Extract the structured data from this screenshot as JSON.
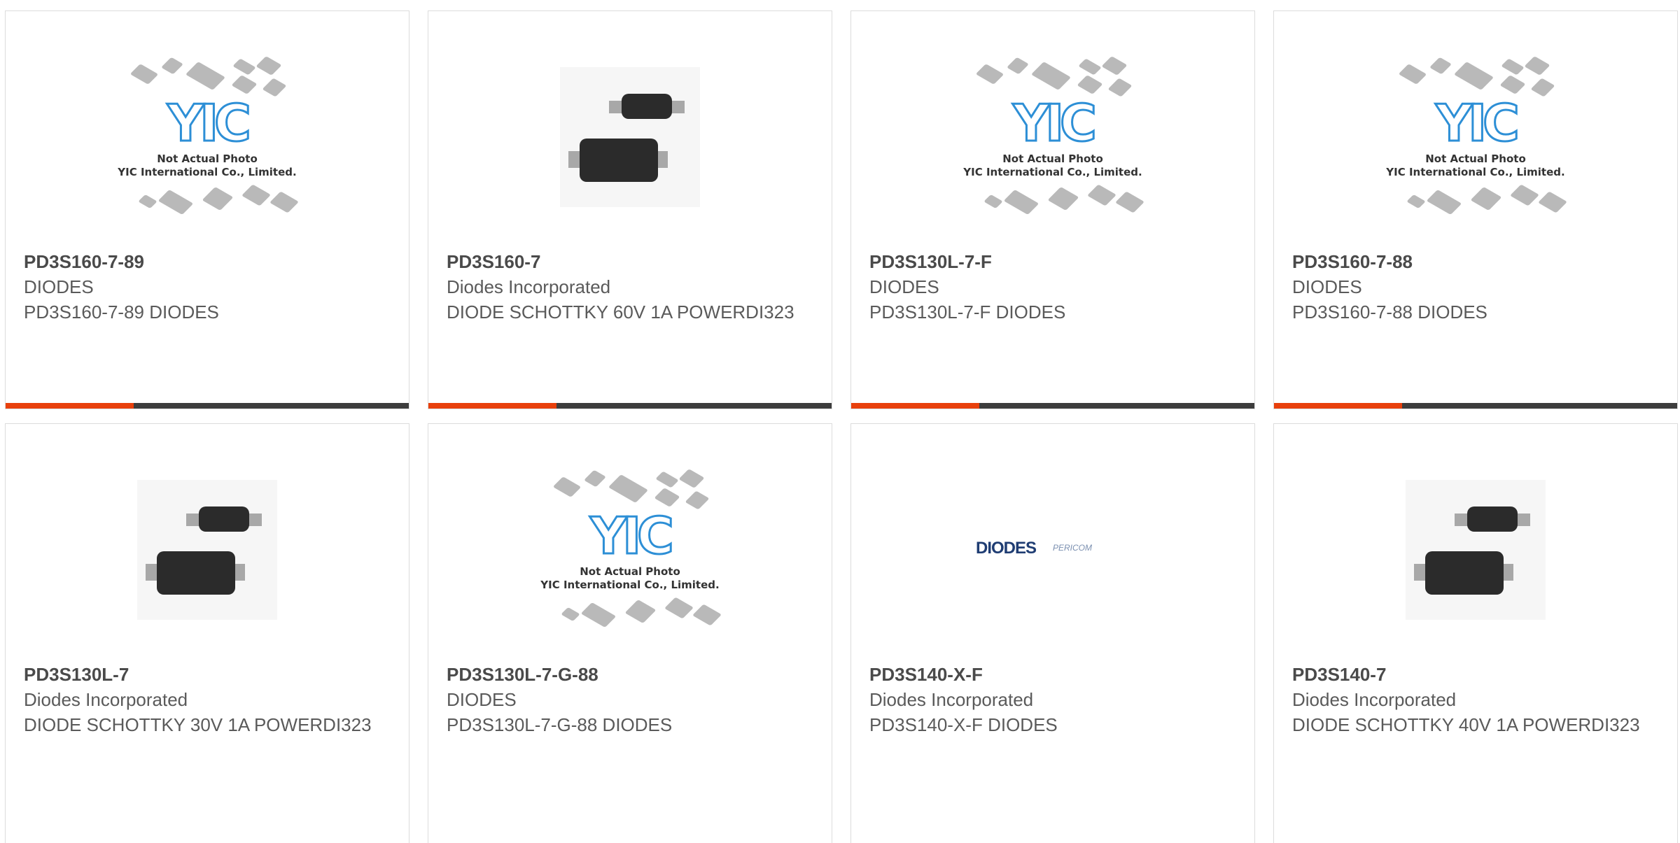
{
  "placeholder": {
    "brand": "YIC",
    "line1": "Not Actual Photo",
    "line2": "YIC International Co., Limited."
  },
  "logo": {
    "diodes": "DIODES",
    "pericom": "PERICOM"
  },
  "products": [
    {
      "part": "PD3S160-7-89",
      "manufacturer": "DIODES",
      "description": "PD3S160-7-89 DIODES",
      "image": "placeholder"
    },
    {
      "part": "PD3S160-7",
      "manufacturer": "Diodes Incorporated",
      "description": "DIODE SCHOTTKY 60V 1A POWERDI323",
      "image": "diode-photo"
    },
    {
      "part": "PD3S130L-7-F",
      "manufacturer": "DIODES",
      "description": "PD3S130L-7-F DIODES",
      "image": "placeholder"
    },
    {
      "part": "PD3S160-7-88",
      "manufacturer": "DIODES",
      "description": "PD3S160-7-88 DIODES",
      "image": "placeholder"
    },
    {
      "part": "PD3S130L-7",
      "manufacturer": "Diodes Incorporated",
      "description": "DIODE SCHOTTKY 30V 1A POWERDI323",
      "image": "diode-photo"
    },
    {
      "part": "PD3S130L-7-G-88",
      "manufacturer": "DIODES",
      "description": "PD3S130L-7-G-88 DIODES",
      "image": "placeholder"
    },
    {
      "part": "PD3S140-X-F",
      "manufacturer": "Diodes Incorporated",
      "description": "PD3S140-X-F DIODES",
      "image": "brand-logo"
    },
    {
      "part": "PD3S140-7",
      "manufacturer": "Diodes Incorporated",
      "description": "DIODE SCHOTTKY 40V 1A POWERDI323",
      "image": "diode-photo"
    }
  ],
  "colors": {
    "accent": "#e8400c",
    "bar": "#3d3d3d",
    "border": "#dcdcdc"
  }
}
